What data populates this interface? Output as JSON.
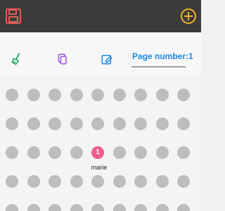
{
  "toolbar": {
    "page_number_label": "Page number:1"
  },
  "icons": {
    "save": "save-icon",
    "add": "add-circle-icon",
    "broom": "broom-icon",
    "copy": "copy-icon",
    "edit": "edit-icon"
  },
  "colors": {
    "topbar": "#3b3b3b",
    "save_icon": "#e35b58",
    "add_icon": "#f0b429",
    "broom_icon": "#22a55b",
    "copy_icon": "#9c4fd8",
    "edit_icon": "#1e88e5",
    "seat_empty": "#bdbdbd",
    "seat_active": "#ef5e8f",
    "page_number_text": "#1e88e5"
  },
  "seat_grid": {
    "rows": 5,
    "cols": 9,
    "active_seats": [
      {
        "row": 3,
        "col": 5,
        "number": "1",
        "name": "marie"
      }
    ]
  }
}
